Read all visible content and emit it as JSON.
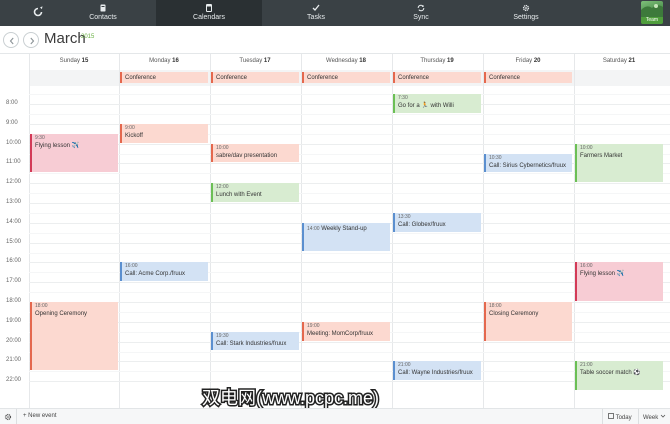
{
  "nav": {
    "tabs": [
      {
        "label": "Contacts",
        "icon": "contacts-icon"
      },
      {
        "label": "Calendars",
        "icon": "calendar-icon"
      },
      {
        "label": "Tasks",
        "icon": "tasks-icon"
      },
      {
        "label": "Sync",
        "icon": "sync-icon"
      },
      {
        "label": "Settings",
        "icon": "settings-icon"
      }
    ],
    "active_tab": "Calendars",
    "user_name": "Team"
  },
  "header": {
    "month": "March",
    "year": "2015"
  },
  "days": [
    {
      "name": "Sunday",
      "num": "15"
    },
    {
      "name": "Monday",
      "num": "16"
    },
    {
      "name": "Tuesday",
      "num": "17"
    },
    {
      "name": "Wednesday",
      "num": "18"
    },
    {
      "name": "Thursday",
      "num": "19"
    },
    {
      "name": "Friday",
      "num": "20"
    },
    {
      "name": "Saturday",
      "num": "21"
    }
  ],
  "hours": [
    "8:00",
    "9:00",
    "10:00",
    "11:00",
    "12:00",
    "13:00",
    "14:00",
    "15:00",
    "16:00",
    "17:00",
    "18:00",
    "19:00",
    "20:00",
    "21:00",
    "22:00"
  ],
  "allday_label": "Conference",
  "events": [
    {
      "day": 4,
      "start": "7:30",
      "title": "Go for a 🏃 with Willi",
      "color": "green"
    },
    {
      "day": 0,
      "start": "9:30",
      "title": "Flying lesson ✈️",
      "color": "pink"
    },
    {
      "day": 1,
      "start": "9:00",
      "title": "Kickoff",
      "color": "red"
    },
    {
      "day": 2,
      "start": "10:00",
      "title": "sabre/dav presentation",
      "color": "red"
    },
    {
      "day": 5,
      "start": "10:30",
      "title": "Call: Sirius Cybernetics/fruux",
      "color": "blue"
    },
    {
      "day": 6,
      "start": "10:00",
      "title": "Farmers Market",
      "color": "green"
    },
    {
      "day": 2,
      "start": "12:00",
      "title": "Lunch with Event",
      "color": "green"
    },
    {
      "day": 3,
      "start": "14:00",
      "title": "Weekly Stand-up",
      "color": "blue"
    },
    {
      "day": 4,
      "start": "13:30",
      "title": "Call: Globex/fruux",
      "color": "blue"
    },
    {
      "day": 1,
      "start": "16:00",
      "title": "Call: Acme Corp./fruux",
      "color": "blue"
    },
    {
      "day": 6,
      "start": "16:00",
      "title": "Flying lesson ✈️",
      "color": "pink"
    },
    {
      "day": 0,
      "start": "18:00",
      "title": "Opening Ceremony",
      "color": "red"
    },
    {
      "day": 5,
      "start": "18:00",
      "title": "Closing Ceremony",
      "color": "red"
    },
    {
      "day": 3,
      "start": "19:00",
      "title": "Meeting: MomCorp/fruux",
      "color": "red"
    },
    {
      "day": 2,
      "start": "19:30",
      "title": "Call: Stark Industries/fruux",
      "color": "blue"
    },
    {
      "day": 4,
      "start": "21:00",
      "title": "Call: Wayne Industries/fruux",
      "color": "blue"
    },
    {
      "day": 6,
      "start": "21:00",
      "title": "Table soccer match ⚽",
      "color": "green"
    }
  ],
  "watermark": "双电网(www.pcpc.me)",
  "footer": {
    "new_event": "New event",
    "today": "Today",
    "view": "Week"
  },
  "colors": {
    "nav_bg": "#3a4145",
    "accent": "#69b143"
  }
}
